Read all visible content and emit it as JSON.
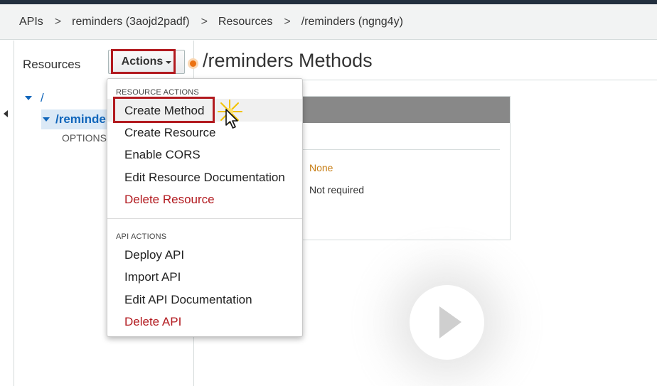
{
  "breadcrumb": {
    "items": [
      "APIs",
      "reminders (3aojd2padf)",
      "Resources",
      "/reminders (ngng4y)"
    ],
    "separator": ">"
  },
  "resources_panel": {
    "title": "Resources",
    "actions_label": "Actions",
    "tree": {
      "root": "/",
      "child": "/reminders",
      "method": "OPTIONS"
    }
  },
  "main": {
    "title": "/reminders Methods",
    "card": {
      "value_1": "None",
      "value_2": "Not required"
    }
  },
  "actions_menu": {
    "resource_section": "RESOURCE ACTIONS",
    "resource_items": [
      {
        "label": "Create Method",
        "danger": false
      },
      {
        "label": "Create Resource",
        "danger": false
      },
      {
        "label": "Enable CORS",
        "danger": false
      },
      {
        "label": "Edit Resource Documentation",
        "danger": false
      },
      {
        "label": "Delete Resource",
        "danger": true
      }
    ],
    "api_section": "API ACTIONS",
    "api_items": [
      {
        "label": "Deploy API",
        "danger": false
      },
      {
        "label": "Import API",
        "danger": false
      },
      {
        "label": "Edit API Documentation",
        "danger": false
      },
      {
        "label": "Delete API",
        "danger": true
      }
    ]
  },
  "icons": {
    "collapse": "collapse-left-icon",
    "tree_expand": "triangle-down-icon",
    "title_marker": "resource-dot-icon",
    "cursor": "mouse-pointer-icon",
    "click": "click-sparkle-icon",
    "video": "play-icon"
  },
  "colors": {
    "highlight": "#b21a1f",
    "link": "#1166bb",
    "danger": "#b21a1f",
    "warning_text": "#c77d14",
    "accent": "#ec7211",
    "card_header": "#888888"
  }
}
